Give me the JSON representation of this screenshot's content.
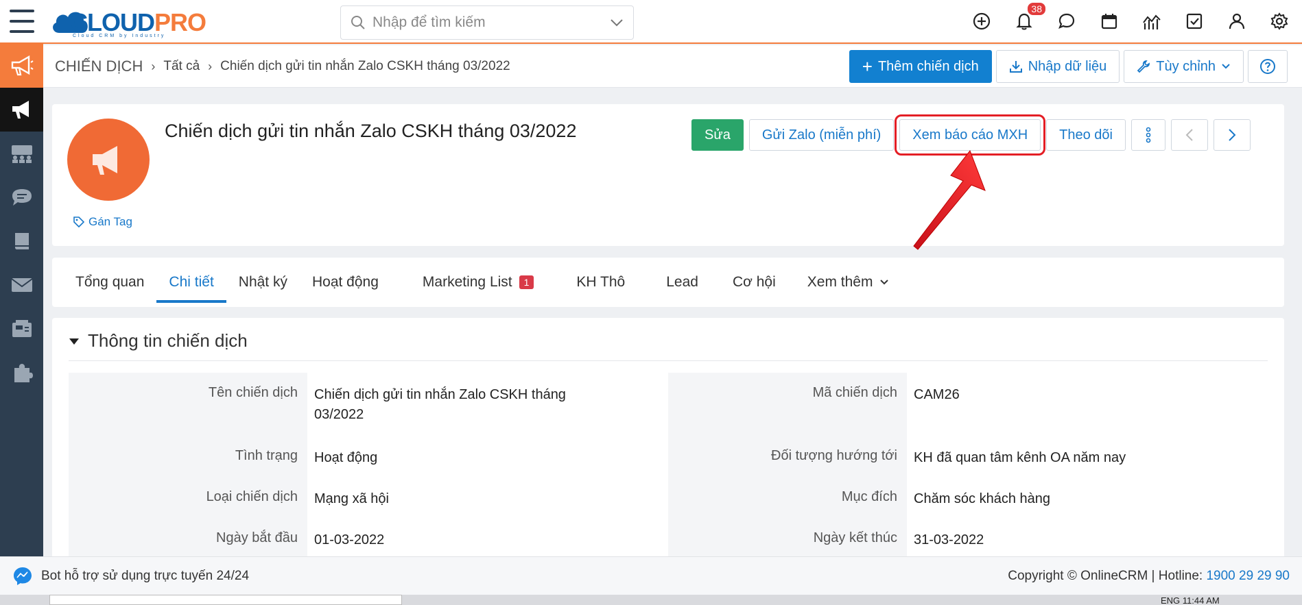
{
  "header": {
    "logo_main": "CLOUD",
    "logo_accent": "PRO",
    "logo_tagline": "Cloud CRM by Industry",
    "search_placeholder": "Nhập để tìm kiếm",
    "notification_count": "38"
  },
  "breadcrumb": {
    "root": "CHIẾN DỊCH",
    "level1": "Tất cả",
    "level2": "Chiến dịch gửi tin nhắn Zalo CSKH tháng 03/2022"
  },
  "toolbar": {
    "add_label": "Thêm chiến dịch",
    "import_label": "Nhập dữ liệu",
    "customize_label": "Tùy chỉnh"
  },
  "record": {
    "title": "Chiến dịch gửi tin nhắn Zalo CSKH tháng 03/2022",
    "tag_label": "Gán Tag",
    "actions": {
      "edit": "Sửa",
      "send_zalo": "Gửi Zalo (miễn phí)",
      "social_report": "Xem báo cáo MXH",
      "follow": "Theo dõi"
    }
  },
  "tabs": [
    {
      "label": "Tổng quan"
    },
    {
      "label": "Chi tiết"
    },
    {
      "label": "Nhật ký"
    },
    {
      "label": "Hoạt động"
    },
    {
      "label": "Marketing List",
      "badge": "1"
    },
    {
      "label": "KH Thô"
    },
    {
      "label": "Lead"
    },
    {
      "label": "Cơ hội"
    },
    {
      "label": "Xem thêm"
    }
  ],
  "section": {
    "title": "Thông tin chiến dịch",
    "left_fields": [
      {
        "label": "Tên chiến dịch",
        "value": "Chiến dịch gửi tin nhắn Zalo CSKH tháng 03/2022"
      },
      {
        "label": "Tình trạng",
        "value": "Hoạt động"
      },
      {
        "label": "Loại chiến dịch",
        "value": "Mạng xã hội"
      },
      {
        "label": "Ngày bắt đầu",
        "value": "01-03-2022"
      }
    ],
    "right_fields": [
      {
        "label": "Mã chiến dịch",
        "value": "CAM26"
      },
      {
        "label": "Đối tượng hướng tới",
        "value": "KH đã quan tâm kênh OA năm nay"
      },
      {
        "label": "Mục đích",
        "value": "Chăm sóc khách hàng"
      },
      {
        "label": "Ngày kết thúc",
        "value": "31-03-2022"
      }
    ]
  },
  "footer": {
    "bot_text": "Bot hỗ trợ sử dụng trực tuyến 24/24",
    "copyright": "Copyright © OnlineCRM | Hotline:",
    "hotline": "1900 29 29 90"
  },
  "taskbar": {
    "clock": "ENG    11:44 AM"
  },
  "colors": {
    "brand_blue": "#1280d0",
    "brand_orange": "#f47c3c",
    "sidebar": "#2d3e50",
    "edit_green": "#2aa56a",
    "annotation_red": "#e41e25"
  }
}
